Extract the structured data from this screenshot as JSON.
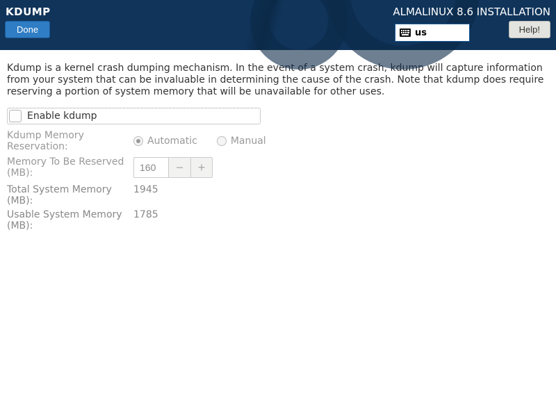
{
  "header": {
    "title": "KDUMP",
    "subtitle": "ALMALINUX 8.6 INSTALLATION",
    "done_label": "Done",
    "help_label": "Help!",
    "keyboard_layout": "us"
  },
  "description": "Kdump is a kernel crash dumping mechanism. In the event of a system crash, kdump will capture information from your system that can be invaluable in determining the cause of the crash. Note that kdump does require reserving a portion of system memory that will be unavailable for other uses.",
  "enable": {
    "label": "Enable kdump",
    "checked": false
  },
  "reservation": {
    "label": "Kdump Memory Reservation:",
    "automatic_label": "Automatic",
    "manual_label": "Manual",
    "selected": "automatic"
  },
  "memory_to_reserve": {
    "label": "Memory To Be Reserved (MB):",
    "value": "160",
    "minus": "−",
    "plus": "+"
  },
  "total_memory": {
    "label": "Total System Memory (MB):",
    "value": "1945"
  },
  "usable_memory": {
    "label": "Usable System Memory (MB):",
    "value": "1785"
  }
}
